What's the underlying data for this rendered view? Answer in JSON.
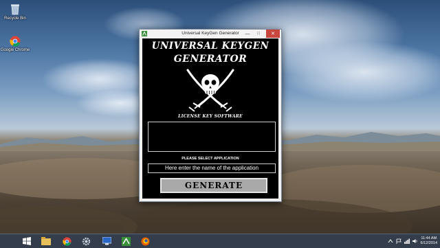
{
  "desktop": {
    "icons": [
      {
        "label": "Recycle Bin",
        "icon": "recycle-bin-icon"
      },
      {
        "label": "Google Chrome",
        "icon": "chrome-icon"
      }
    ]
  },
  "window": {
    "title": "Universal KeyGen Generator",
    "controls": {
      "minimize": "—",
      "maximize": "□",
      "close": "✕"
    },
    "heading_line1": "UNIVERSAL KEYGEN",
    "heading_line2": "GENERATOR",
    "subtitle": "LICENSE KEY SOFTWARE",
    "license_key_output": "",
    "select_label": "PLEASE SELECT APPLICATION",
    "app_field": {
      "value": "Here enter the name of the application"
    },
    "generate_label": "GENERATE"
  },
  "taskbar": {
    "apps": [
      "start-icon",
      "ie-icon",
      "file-explorer-icon",
      "chrome-icon",
      "settings-icon",
      "store-icon",
      "keygen-icon",
      "firefox-icon"
    ],
    "clock": {
      "time": "11:44 AM",
      "date": "6/12/2014"
    }
  }
}
